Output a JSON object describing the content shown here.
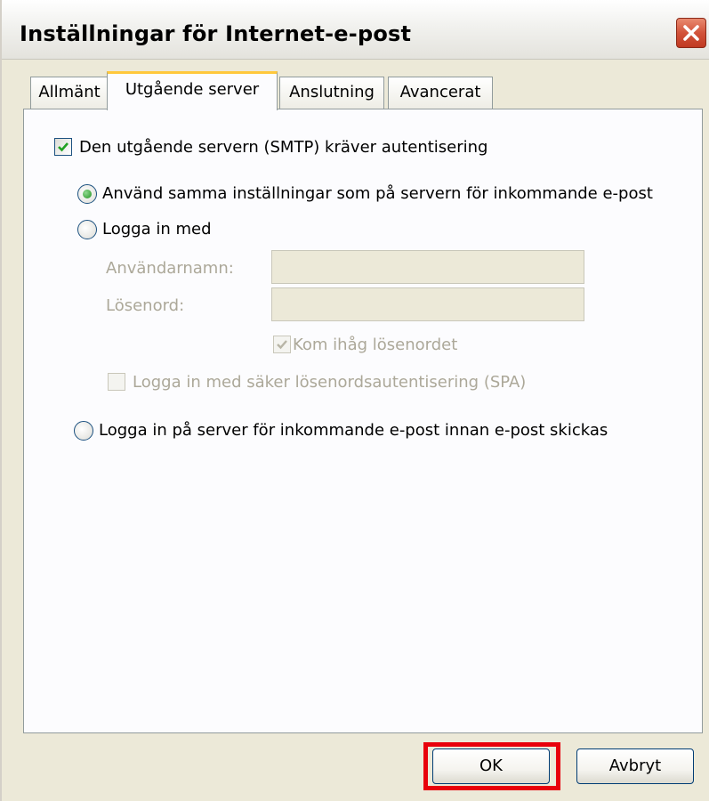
{
  "window": {
    "title": "Inställningar för Internet-e-post"
  },
  "tabs": [
    {
      "label": "Allmänt",
      "active": false
    },
    {
      "label": "Utgående server",
      "active": true
    },
    {
      "label": "Anslutning",
      "active": false
    },
    {
      "label": "Avancerat",
      "active": false
    }
  ],
  "outgoing_server": {
    "smtp_auth_label": "Den utgående servern (SMTP) kräver autentisering",
    "smtp_auth_checked": true,
    "use_same_settings_label": "Använd samma inställningar som på servern för inkommande e-post",
    "use_same_settings_selected": true,
    "log_on_with_label": "Logga in med",
    "log_on_with_selected": false,
    "username_label": "Användarnamn:",
    "username_value": "",
    "password_label": "Lösenord:",
    "password_value": "",
    "remember_password_label": "Kom ihåg lösenordet",
    "remember_password_checked": true,
    "spa_label": "Logga in med säker lösenordsautentisering (SPA)",
    "spa_checked": false,
    "log_on_incoming_label": "Logga in på server för inkommande e-post innan e-post skickas",
    "log_on_incoming_selected": false
  },
  "buttons": {
    "ok_label": "OK",
    "cancel_label": "Avbryt"
  },
  "colors": {
    "highlight": "#e8000b",
    "tab_accent": "#ffc83c",
    "checkmark": "#21a121"
  }
}
